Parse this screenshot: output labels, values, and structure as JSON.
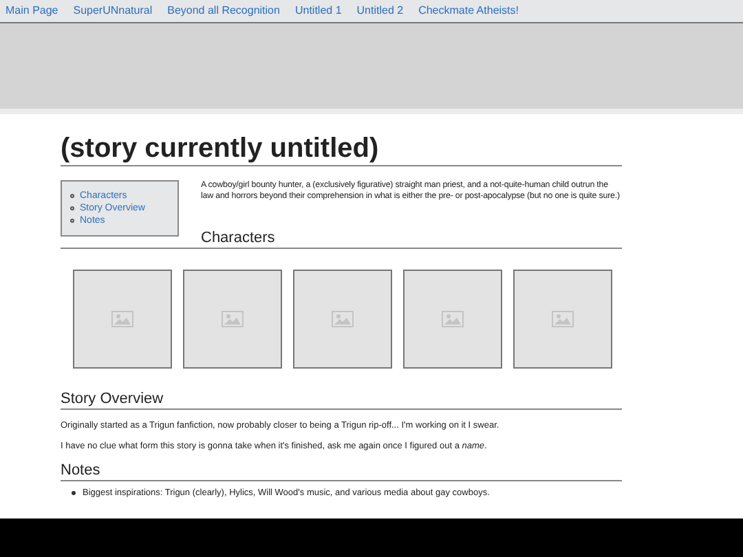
{
  "nav": [
    {
      "label": "Main Page"
    },
    {
      "label": "SuperUNnatural"
    },
    {
      "label": "Beyond all Recognition"
    },
    {
      "label": "Untitled 1"
    },
    {
      "label": "Untitled 2"
    },
    {
      "label": "Checkmate Atheists!"
    }
  ],
  "title": "(story currently untitled)",
  "toc": [
    "Characters",
    "Story Overview",
    "Notes"
  ],
  "summary": "A cowboy/girl bounty hunter, a (exclusively figurative) straight man priest, and a not-quite-human child outrun the law and horrors beyond their comprehension in what is either the pre- or post-apocalypse (but no one is quite sure.)",
  "characters": {
    "heading": "Characters",
    "images": [
      {
        "kind": "placeholder"
      },
      {
        "kind": "placeholder"
      },
      {
        "kind": "placeholder"
      },
      {
        "kind": "placeholder"
      },
      {
        "kind": "placeholder"
      }
    ]
  },
  "overview": {
    "heading": "Story Overview",
    "paragraphs": [
      "Originally started as a Trigun fanfiction, now probably closer to being a Trigun rip-off... I'm working on it I swear.",
      "I have no clue what form this story is gonna take when it's finished, ask me again once I figured out a *name*."
    ]
  },
  "notes": {
    "heading": "Notes",
    "items": [
      "Biggest inspirations: Trigun (clearly), Hylics, Will Wood's music, and various media about gay cowboys."
    ]
  }
}
